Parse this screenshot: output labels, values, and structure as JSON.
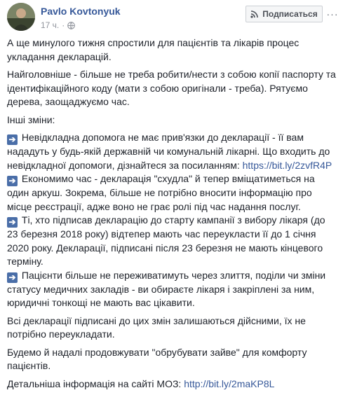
{
  "header": {
    "author": "Pavlo Kovtonyuk",
    "time": "17 ч.",
    "dot": "·",
    "subscribe_label": "Подписаться",
    "more_label": "···"
  },
  "post": {
    "p1": "А ще минулого тижня спростили для пацієнтів та лікарів процес укладання декларацій.",
    "p2": "Найголовніше - більше не треба робити/нести з собою копії паспорту та ідентифікаційного коду (мати з собою оригінали - треба). Рятуємо дерева, заощаджуємо час.",
    "p3_heading": "Інші зміни:",
    "bullets": [
      {
        "text": "Невідкладна допомога не має прив'язки до декларації - її вам нададуть у будь-якій державній чи комунальній лікарні. Що входить до невідкладної допомоги, дізнайтеся за посиланням: ",
        "link": "https://bit.ly/2zvfR4P"
      },
      {
        "text": "Економимо час - декларація \"схудла\" й тепер вміщатиметься на один аркуш. Зокрема, більше не потрібно вносити інформацію про місце реєстрації, адже воно не грає ролі під час надання послуг.",
        "link": ""
      },
      {
        "text": "Ті, хто підписав декларацію до старту кампанії з вибору лікаря (до 23 березня 2018 року) відтепер мають час переукласти її до 1 січня 2020 року. Декларації, підписані після 23 березня не мають кінцевого терміну.",
        "link": ""
      },
      {
        "text": "Пацієнти більше не переживатимуть через злиття, поділи чи зміни статусу медичних закладів - ви обираєте лікаря і закріплені за ним, юридичні тонкощі не мають вас цікавити.",
        "link": ""
      }
    ],
    "p4": "Всі декларації підписані до цих змін залишаються дійсними, їх не потрібно переукладати.",
    "p5": "Будемо й надалі продовжувати \"обрубувати зайве\" для комфорту пацієнтів.",
    "p6_text": "Детальніша інформація на сайті МОЗ: ",
    "p6_link": "http://bit.ly/2maKP8L"
  },
  "colors": {
    "link": "#365899",
    "text": "#1d2129",
    "meta": "#90949c",
    "arrow_bg": "#4a6ea8"
  },
  "icons": [
    "avatar",
    "globe-icon",
    "rss-icon",
    "arrow-right-icon",
    "more-icon"
  ]
}
